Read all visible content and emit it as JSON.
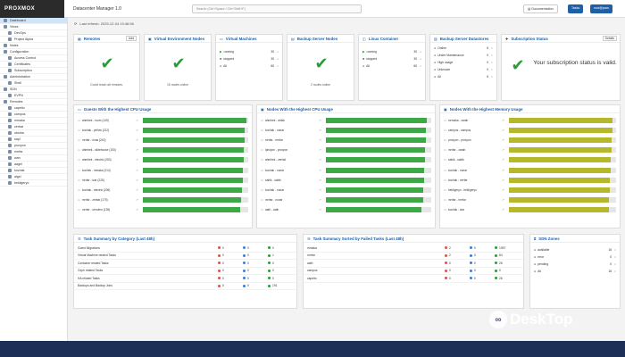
{
  "app": {
    "logo": "PROXMOX",
    "title": "Datacenter Manager 1.0"
  },
  "search": {
    "placeholder": "Search (Ctrl+Space / Ctrl+Shift+F)"
  },
  "header_buttons": {
    "docs": "Documentation",
    "theme": "Tasks",
    "user": "root@pam"
  },
  "sidebar": [
    {
      "label": "Dashboard",
      "level": 0,
      "selected": true
    },
    {
      "label": "Views",
      "level": 0
    },
    {
      "label": "DevOps",
      "level": 1
    },
    {
      "label": "Project Alpha",
      "level": 1
    },
    {
      "label": "Notes",
      "level": 0
    },
    {
      "label": "Configuration",
      "level": 0
    },
    {
      "label": "Access Control",
      "level": 1
    },
    {
      "label": "Certificates",
      "level": 1
    },
    {
      "label": "Subscription",
      "level": 1
    },
    {
      "label": "Administration",
      "level": 0
    },
    {
      "label": "Shell",
      "level": 1
    },
    {
      "label": "SDN",
      "level": 0
    },
    {
      "label": "EVPN",
      "level": 1
    },
    {
      "label": "Remotes",
      "level": 0
    },
    {
      "label": "capeito",
      "level": 1
    },
    {
      "label": "campus",
      "level": 1
    },
    {
      "label": "mmaka",
      "level": 1
    },
    {
      "label": "zerbat",
      "level": 1
    },
    {
      "label": "ubrolia",
      "level": 1
    },
    {
      "label": "sapi",
      "level": 1
    },
    {
      "label": "proxyon",
      "level": 1
    },
    {
      "label": "mrrfar",
      "level": 1
    },
    {
      "label": "wan",
      "level": 1
    },
    {
      "label": "aagel",
      "level": 1
    },
    {
      "label": "kochak",
      "level": 1
    },
    {
      "label": "algei",
      "level": 1
    },
    {
      "label": "bekligeryo",
      "level": 1
    }
  ],
  "last_refresh": "Last refresh: 2025-12-04 19:46:56",
  "remotes": {
    "title": "Remotes",
    "btn": "Add",
    "note": "Could reach all remotes."
  },
  "vnodes": {
    "title": "Virtual Environment Nodes",
    "note": "15 nodes online"
  },
  "vms": {
    "title": "Virtual Machines",
    "rows": [
      {
        "label": "running",
        "value": "30"
      },
      {
        "label": "stopped",
        "value": "30"
      },
      {
        "label": "All",
        "value": "60"
      }
    ]
  },
  "backup": {
    "title": "Backup Server Nodes",
    "note": "2 nodes online"
  },
  "lxc": {
    "title": "Linux Container",
    "rows": [
      {
        "label": "running",
        "value": "30"
      },
      {
        "label": "stopped",
        "value": "30"
      },
      {
        "label": "All",
        "value": "60"
      }
    ]
  },
  "datastores": {
    "title": "Backup Server Datastores",
    "rows": [
      {
        "label": "Online",
        "value": "6"
      },
      {
        "label": "Under Maintenance",
        "value": "0"
      },
      {
        "label": "High usage",
        "value": "0"
      },
      {
        "label": "Unknown",
        "value": "0"
      },
      {
        "label": "All",
        "value": "6"
      }
    ]
  },
  "subscription": {
    "title": "Subscription Status",
    "btn": "Details",
    "message": "Your subscription status is valid."
  },
  "guests_cpu": {
    "title": "Guests With the Highest CPU Usage",
    "rows": [
      {
        "name": "ahmbek - room (149)",
        "value": 0.98
      },
      {
        "name": "kochak - yellow (212)",
        "value": 0.97
      },
      {
        "name": "mrrfar - rivas (240)",
        "value": 0.97
      },
      {
        "name": "ahmbek - slidehouse (153)",
        "value": 0.96
      },
      {
        "name": "ahmbek - electric (253)",
        "value": 0.96
      },
      {
        "name": "kochek - mmaka (214)",
        "value": 0.95
      },
      {
        "name": "mrrfar - izar (225)",
        "value": 0.95
      },
      {
        "name": "kochak - electric (206)",
        "value": 0.94
      },
      {
        "name": "mrrfar - zerbat (175)",
        "value": 0.93
      },
      {
        "name": "mrrfar - ubrolem (135)",
        "value": 0.92
      }
    ]
  },
  "nodes_cpu": {
    "title": "Nodes With the Highest CPU Usage",
    "rows": [
      {
        "name": "ahmbek - ahlak",
        "value": 0.96
      },
      {
        "name": "kochak - nunar",
        "value": 0.95
      },
      {
        "name": "mrrfar - mrrfar",
        "value": 0.95
      },
      {
        "name": "ipisryon - proxyon",
        "value": 0.94
      },
      {
        "name": "ahmbek - zerbat",
        "value": 0.94
      },
      {
        "name": "kochak - nunar",
        "value": 0.93
      },
      {
        "name": "sabik - sabik",
        "value": 0.93
      },
      {
        "name": "kochak - nunar",
        "value": 0.92
      },
      {
        "name": "mrrfar - nunar",
        "value": 0.92
      },
      {
        "name": "aath - aath",
        "value": 0.91
      }
    ]
  },
  "nodes_mem": {
    "title": "Nodes With the Highest Memory Usage",
    "rows": [
      {
        "name": "mrmaka - zarah",
        "value": 0.97
      },
      {
        "name": "campus - campus",
        "value": 0.97
      },
      {
        "name": "proxyon - proxyon",
        "value": 0.96
      },
      {
        "name": "mrrfar - zarah",
        "value": 0.96
      },
      {
        "name": "sabik - sabik",
        "value": 0.95
      },
      {
        "name": "kochak - nunar",
        "value": 0.95
      },
      {
        "name": "kochak - mrrfar",
        "value": 0.94
      },
      {
        "name": "bekligeryo - bekligeryo",
        "value": 0.94
      },
      {
        "name": "mrrfar - mrrfar",
        "value": 0.93
      },
      {
        "name": "kochak - izar",
        "value": 0.93
      }
    ]
  },
  "task_cat": {
    "title": "Task Summary by Category (Last 48h)",
    "rows": [
      {
        "label": "Guest Migrations",
        "red": "0",
        "blue": "0",
        "green": "0"
      },
      {
        "label": "Virtual Machine related Tasks",
        "red": "0",
        "blue": "0",
        "green": "1"
      },
      {
        "label": "Container related Tasks",
        "red": "0",
        "blue": "0",
        "green": "0"
      },
      {
        "label": "Ceph related Tasks",
        "red": "0",
        "blue": "0",
        "green": "0"
      },
      {
        "label": "HA related Tasks",
        "red": "0",
        "blue": "0",
        "green": "0"
      },
      {
        "label": "Backups and Backup Jobs",
        "red": "0",
        "blue": "0",
        "green": "191"
      }
    ]
  },
  "task_failed": {
    "title": "Task Summary Sorted by Failed Tasks (Last 48h)",
    "rows": [
      {
        "label": "mmaka",
        "red": "2",
        "blue": "0",
        "green": "1997"
      },
      {
        "label": "mrrfar",
        "red": "2",
        "blue": "0",
        "green": "84"
      },
      {
        "label": "aath",
        "red": "0",
        "blue": "0",
        "green": "26"
      },
      {
        "label": "campus",
        "red": "0",
        "blue": "0",
        "green": "0"
      },
      {
        "label": "capeito",
        "red": "0",
        "blue": "0",
        "green": "26"
      }
    ]
  },
  "sdn": {
    "title": "SDN Zones",
    "rows": [
      {
        "label": "available",
        "value": "16"
      },
      {
        "label": "error",
        "value": "0"
      },
      {
        "label": "pending",
        "value": "0"
      },
      {
        "label": "All",
        "value": "16"
      }
    ]
  },
  "watermark": "DeskTop",
  "colors": {
    "accent": "#1f5fa6",
    "ok": "#2e9a3b",
    "bar_green": "#3da846",
    "bar_olive": "#b5b82a"
  }
}
